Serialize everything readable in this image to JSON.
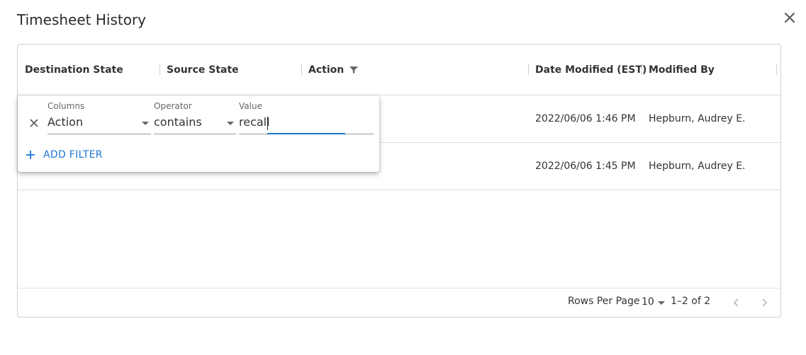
{
  "dialog": {
    "title": "Timesheet History"
  },
  "grid": {
    "columns": [
      {
        "label": "Destination State"
      },
      {
        "label": "Source State"
      },
      {
        "label": "Action",
        "filtered": true
      },
      {
        "label": "Date Modified (EST)"
      },
      {
        "label": "Modified By"
      }
    ],
    "rows": [
      {
        "date_modified": "2022/06/06 1:46 PM",
        "modified_by": "Hepburn, Audrey E."
      },
      {
        "date_modified": "2022/06/06 1:45 PM",
        "modified_by": "Hepburn, Audrey E."
      }
    ]
  },
  "filter_panel": {
    "columns_label": "Columns",
    "columns_value": "Action",
    "operator_label": "Operator",
    "operator_value": "contains",
    "value_label": "Value",
    "value_value": "recall",
    "add_filter_label": "ADD FILTER",
    "accent_color": "#1c76d2"
  },
  "pagination": {
    "rows_per_page_label": "Rows Per Page",
    "rows_per_page_value": "10",
    "range_text": "1–2 of 2"
  },
  "icons": {
    "close": "close-icon",
    "filter": "filter-icon",
    "remove_filter": "remove-filter-icon",
    "add": "plus-icon",
    "prev": "chevron-left-icon",
    "next": "chevron-right-icon"
  }
}
